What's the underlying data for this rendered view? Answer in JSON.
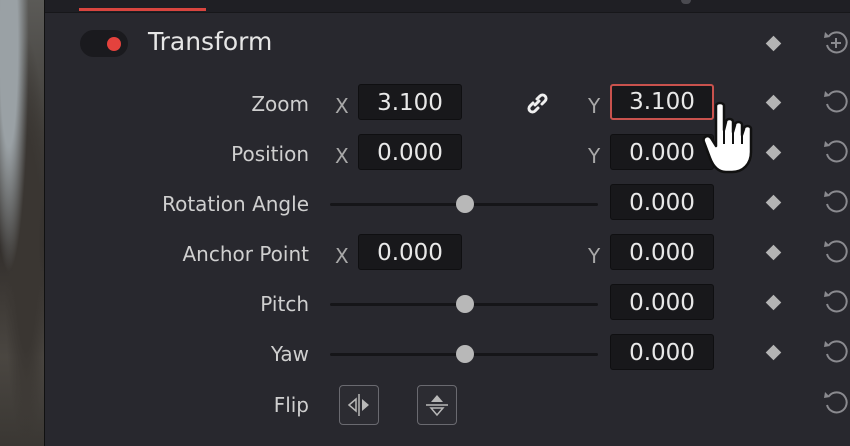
{
  "section": {
    "title": "Transform",
    "enabled": true,
    "accent_color": "#e4423d"
  },
  "rows": [
    {
      "label": "Zoom",
      "x_axis": "X",
      "x_value": "3.100",
      "y_axis": "Y",
      "y_value": "3.100"
    },
    {
      "label": "Position",
      "x_axis": "X",
      "x_value": "0.000",
      "y_axis": "Y",
      "y_value": "0.000"
    },
    {
      "label": "Rotation Angle",
      "value": "0.000",
      "slider_fraction": 0.5
    },
    {
      "label": "Anchor Point",
      "x_axis": "X",
      "x_value": "0.000",
      "y_axis": "Y",
      "y_value": "0.000"
    },
    {
      "label": "Pitch",
      "value": "0.000",
      "slider_fraction": 0.5
    },
    {
      "label": "Yaw",
      "value": "0.000",
      "slider_fraction": 0.5
    },
    {
      "label": "Flip"
    }
  ],
  "icons": {
    "enable_toggle": "toggle-on",
    "zoom_link": "link-icon",
    "keyframe": "diamond-icon",
    "reset": "reset-arrow-icon",
    "section_reset": "add-reset-icon",
    "flip_horizontal": "flip-horizontal-icon",
    "flip_vertical": "flip-vertical-icon",
    "cursor": "hand-pointer-icon"
  }
}
